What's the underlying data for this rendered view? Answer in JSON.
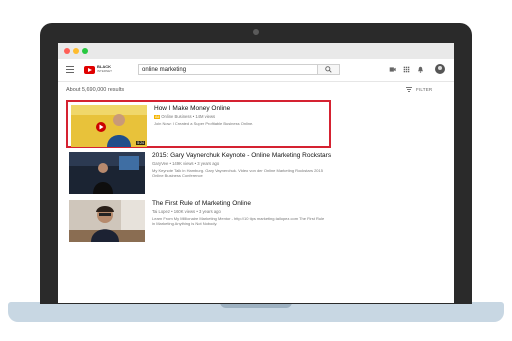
{
  "search": {
    "query": "online marketing"
  },
  "logo": {
    "line1": "BLACK",
    "line2": "INTERNET"
  },
  "results_header": {
    "count": "About 5,690,000 results",
    "filter_label": "FILTER"
  },
  "results": [
    {
      "title": "How I Make Money Online",
      "channel": "Online Business",
      "meta": "• 14M views",
      "description": "Join Now: I Created a Super Profitable Business Online.",
      "duration": "5:24",
      "highlighted": true
    },
    {
      "title": "2015: Gary Vaynerchuk Keynote - Online Marketing Rockstars",
      "channel": "GaryVee",
      "meta": "• 149K views • 3 years ago",
      "description": "My Keynote Talk in Hamburg. Gary Vaynerchuk. Video von der Online Marketing Rockstars 2015 Online Business Conference",
      "duration": "",
      "highlighted": false
    },
    {
      "title": "The First Rule of Marketing Online",
      "channel": "Tai Lopez",
      "meta": "• 160K views • 3 years ago",
      "description": "Learn From My Millionaire Marketing Mentor - http://10 tips marketing.tailopez.com The First Rule in Marketing Anything is Not Nobody.",
      "duration": "",
      "highlighted": false
    }
  ],
  "colors": {
    "highlight": "#d52231",
    "yt_red": "#e00000",
    "ad_badge": "#f3b400"
  }
}
